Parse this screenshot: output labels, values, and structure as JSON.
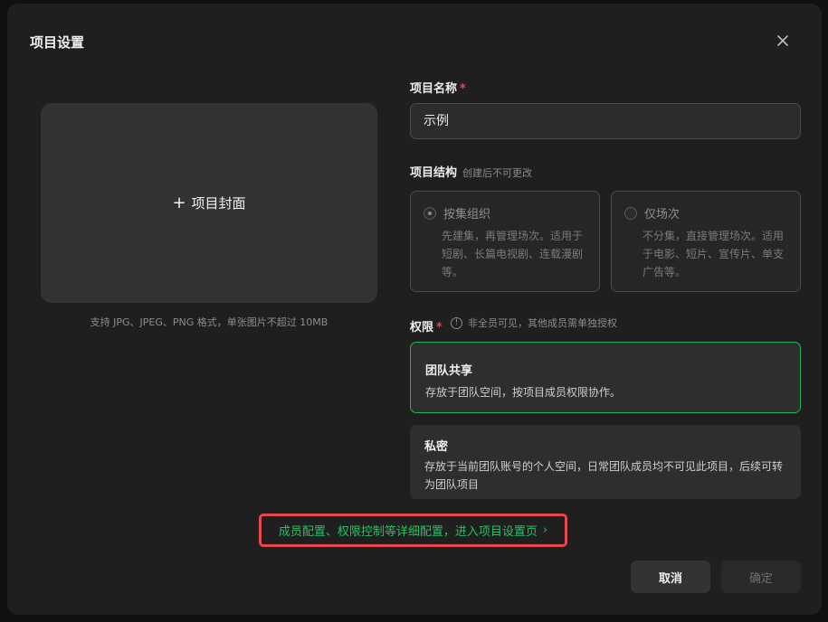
{
  "dialog": {
    "title": "项目设置"
  },
  "cover": {
    "label": "项目封面",
    "plus": "+",
    "hint": "支持 JPG、JPEG、PNG 格式，单张图片不超过 10MB"
  },
  "project_name": {
    "label": "项目名称",
    "required_mark": "*",
    "value": "示例"
  },
  "structure": {
    "label": "项目结构",
    "note": "创建后不可更改",
    "options": [
      {
        "title": "按集组织",
        "description": "先建集，再管理场次。适用于短剧、长篇电视剧、连载漫剧等。",
        "selected": true
      },
      {
        "title": "仅场次",
        "description": "不分集，直接管理场次。适用于电影、短片、宣传片、单支广告等。",
        "selected": false
      }
    ]
  },
  "permission": {
    "label": "权限",
    "required_mark": "*",
    "hint": "非全员可见，其他成员需单独授权",
    "options": [
      {
        "title": "团队共享",
        "description": "存放于团队空间，按项目成员权限协作。",
        "selected": true
      },
      {
        "title": "私密",
        "description": "存放于当前团队账号的个人空间，日常团队成员均不可见此项目，后续可转为团队项目",
        "selected": false
      }
    ]
  },
  "settings_link": {
    "text": "成员配置、权限控制等详细配置，进入项目设置页",
    "chevron": "›"
  },
  "buttons": {
    "cancel": "取消",
    "confirm": "确定"
  },
  "colors": {
    "accent_green": "#21c462",
    "highlight_red": "#e5484d",
    "modal_bg": "#1f1f1f"
  },
  "icons": [
    "close-icon",
    "plus-icon",
    "info-icon",
    "chevron-right-icon"
  ]
}
